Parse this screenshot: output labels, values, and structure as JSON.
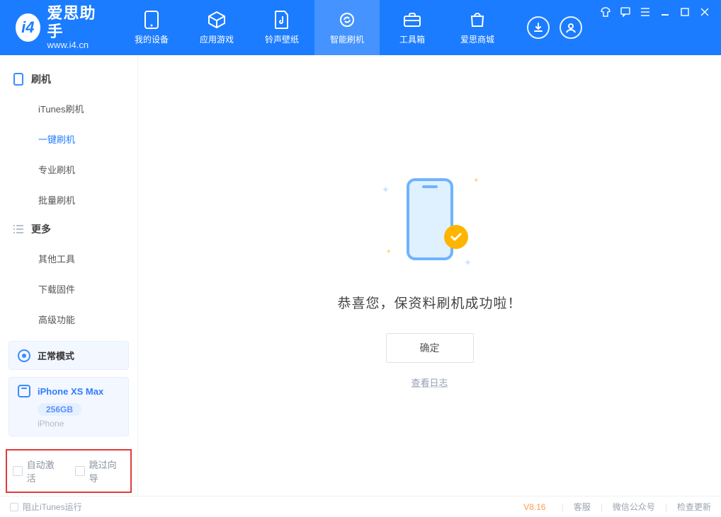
{
  "app": {
    "name": "爱思助手",
    "url": "www.i4.cn"
  },
  "nav": {
    "items": [
      {
        "label": "我的设备"
      },
      {
        "label": "应用游戏"
      },
      {
        "label": "铃声壁纸"
      },
      {
        "label": "智能刷机"
      },
      {
        "label": "工具箱"
      },
      {
        "label": "爱思商城"
      }
    ],
    "activeIndex": 3
  },
  "sidebar": {
    "groups": {
      "flash": {
        "title": "刷机",
        "items": [
          {
            "label": "iTunes刷机"
          },
          {
            "label": "一键刷机"
          },
          {
            "label": "专业刷机"
          },
          {
            "label": "批量刷机"
          }
        ],
        "activeIndex": 1
      },
      "more": {
        "title": "更多",
        "items": [
          {
            "label": "其他工具"
          },
          {
            "label": "下载固件"
          },
          {
            "label": "高级功能"
          }
        ]
      }
    },
    "mode_label": "正常模式",
    "device": {
      "name": "iPhone XS Max",
      "storage": "256GB",
      "os": "iPhone"
    },
    "checks": {
      "auto_activate": "自动激活",
      "skip_guide": "跳过向导"
    }
  },
  "main": {
    "success_title": "恭喜您，保资料刷机成功啦！",
    "ok_label": "确定",
    "view_log": "查看日志"
  },
  "footer": {
    "block_itunes": "阻止iTunes运行",
    "version": "V8.16",
    "links": {
      "support": "客服",
      "wechat": "微信公众号",
      "update": "检查更新"
    }
  }
}
